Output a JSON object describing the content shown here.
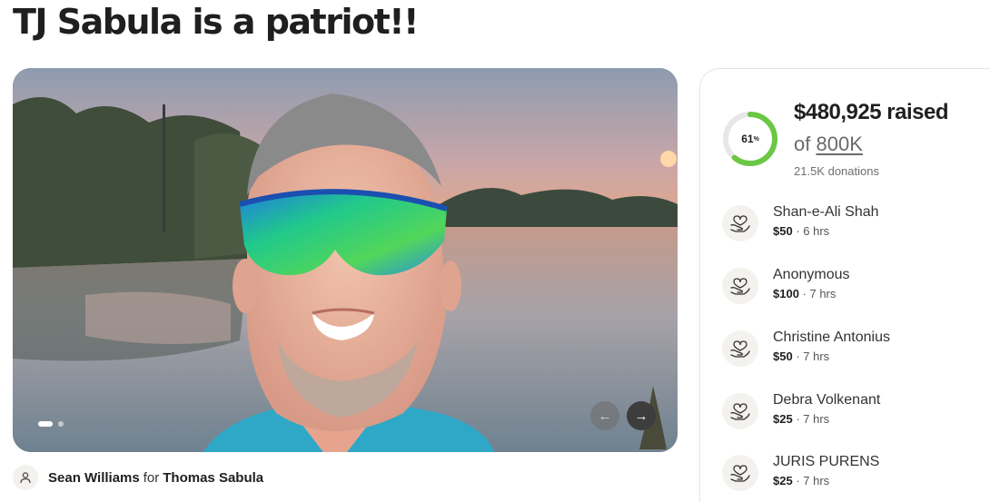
{
  "page": {
    "title": "TJ Sabula is a patriot!!"
  },
  "hero": {
    "image_subject": "selfie of smiling man in mirrored green sport sunglasses by a lake at sunset",
    "prev_arrow": "←",
    "next_arrow": "→",
    "slide_count": 2,
    "active_slide": 1
  },
  "organizer": {
    "name": "Sean Williams",
    "connector": "for",
    "beneficiary": "Thomas Sabula"
  },
  "progress": {
    "percent_value": "61",
    "percent_symbol": "%",
    "fraction": 0.61,
    "raised": "$480,925 raised",
    "of_label": "of",
    "goal": "800K",
    "donations": "21.5K donations",
    "ring_color": "#6bc744",
    "track_color": "#e7e7e7"
  },
  "donors": [
    {
      "name": "Shan-e-Ali Shah",
      "amount": "$50",
      "time": "6 hrs"
    },
    {
      "name": "Anonymous",
      "amount": "$100",
      "time": "7 hrs"
    },
    {
      "name": "Christine Antonius",
      "amount": "$50",
      "time": "7 hrs"
    },
    {
      "name": "Debra Volkenant",
      "amount": "$25",
      "time": "7 hrs"
    },
    {
      "name": "JURIS PURENS",
      "amount": "$25",
      "time": "7 hrs"
    }
  ],
  "icons": {
    "donation": "heart-in-hand-icon",
    "organizer": "user-icon"
  }
}
